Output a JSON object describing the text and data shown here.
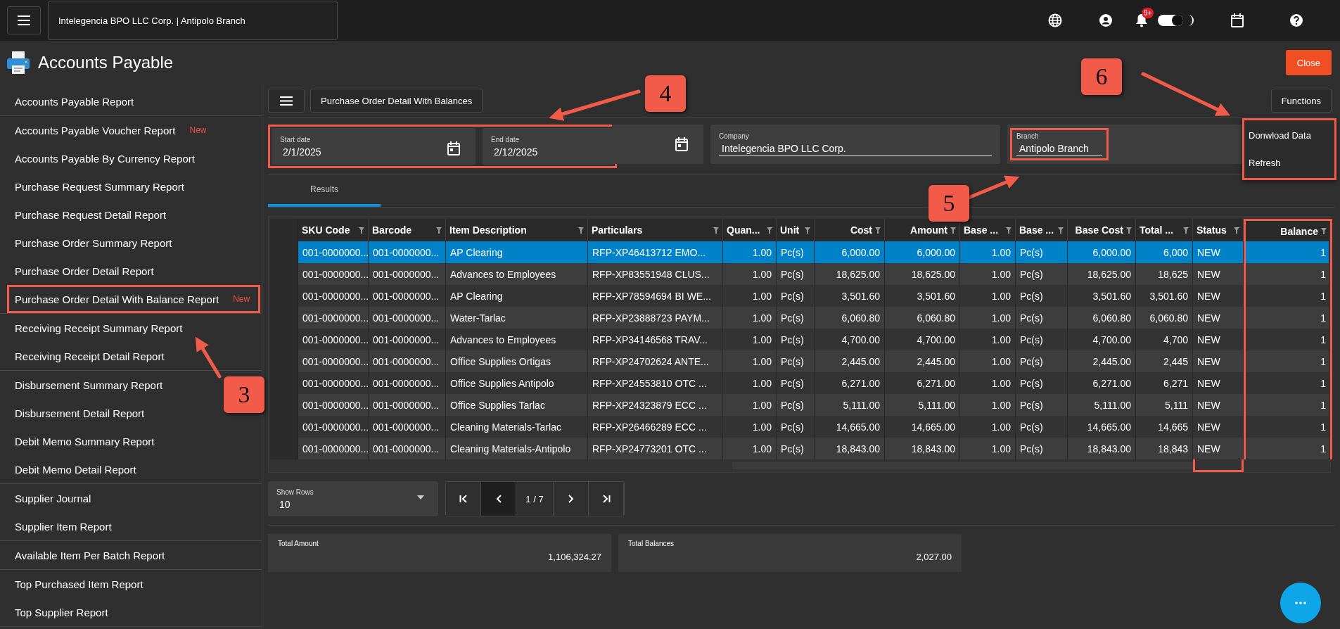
{
  "topbar": {
    "company": "Intelegencia BPO LLC Corp. | Antipolo Branch",
    "notification_count": "9+",
    "dark_mode": true
  },
  "page": {
    "title": "Accounts Payable",
    "close": "Close"
  },
  "sidebar": {
    "groups": [
      [
        {
          "label": "Accounts Payable Report",
          "highlighted": false
        }
      ],
      [
        {
          "label": "Accounts Payable Voucher Report",
          "badge": "New",
          "highlighted": false
        },
        {
          "label": "Accounts Payable By Currency Report",
          "highlighted": false
        },
        {
          "label": "Purchase Request Summary Report",
          "highlighted": false
        },
        {
          "label": "Purchase Request Detail Report",
          "highlighted": false
        },
        {
          "label": "Purchase Order Summary Report",
          "highlighted": false
        },
        {
          "label": "Purchase Order Detail Report",
          "highlighted": false
        },
        {
          "label": "Purchase Order Detail With Balance Report",
          "badge": "New",
          "highlighted": true
        }
      ],
      [
        {
          "label": "Receiving Receipt Summary Report",
          "highlighted": false
        },
        {
          "label": "Receiving Receipt Detail Report",
          "highlighted": false
        }
      ],
      [
        {
          "label": "Disbursement Summary Report",
          "highlighted": false
        },
        {
          "label": "Disbursement Detail Report",
          "highlighted": false
        },
        {
          "label": "Debit Memo Summary Report",
          "highlighted": false
        },
        {
          "label": "Debit Memo Detail Report",
          "highlighted": false
        }
      ],
      [
        {
          "label": "Supplier Journal",
          "highlighted": false
        },
        {
          "label": "Supplier Item Report",
          "highlighted": false
        }
      ],
      [
        {
          "label": "Available Item Per Batch Report",
          "highlighted": false
        }
      ],
      [
        {
          "label": "Top Purchased Item Report",
          "highlighted": false
        },
        {
          "label": "Top Supplier Report",
          "highlighted": false
        }
      ]
    ]
  },
  "toolbar": {
    "report": "Purchase Order Detail With Balances",
    "functions": "Functions"
  },
  "functions_menu": {
    "items": [
      "Donwload Data",
      "Refresh"
    ],
    "outlined": true
  },
  "filters": {
    "date_range_outlined": true,
    "start_date": {
      "label": "Start date",
      "value": "2/1/2025"
    },
    "end_date": {
      "label": "End date",
      "value": "2/12/2025"
    },
    "company": {
      "label": "Company",
      "value": "Intelegencia BPO LLC Corp."
    },
    "branch": {
      "label": "Branch",
      "value": "Antipolo Branch",
      "outlined": true
    }
  },
  "tabs": [
    {
      "label": "Results",
      "selected": true
    }
  ],
  "table": {
    "columns": [
      {
        "label": "SKU Code",
        "outlined": false
      },
      {
        "label": "Barcode",
        "outlined": false
      },
      {
        "label": "Item Description",
        "outlined": false
      },
      {
        "label": "Particulars",
        "outlined": false
      },
      {
        "label": "Quan...",
        "outlined": false
      },
      {
        "label": "Unit",
        "outlined": false
      },
      {
        "label": "Cost",
        "outlined": false
      },
      {
        "label": "Amount",
        "outlined": false
      },
      {
        "label": "Base ...",
        "outlined": false
      },
      {
        "label": "Base ...",
        "outlined": false
      },
      {
        "label": "Base Cost",
        "outlined": false
      },
      {
        "label": "Total ...",
        "outlined": false
      },
      {
        "label": "Status",
        "outlined": false
      },
      {
        "label": "Balance",
        "outlined": true
      }
    ],
    "rows": [
      {
        "selected": true,
        "cells": [
          "001-0000000...",
          "001-0000000...",
          "AP Clearing",
          "RFP-XP46413712 EMO...",
          "1.00",
          "Pc(s)",
          "6,000.00",
          "6,000.00",
          "1.00",
          "Pc(s)",
          "6,000.00",
          "6,000",
          "NEW",
          "1"
        ]
      },
      {
        "selected": false,
        "cells": [
          "001-0000000...",
          "001-0000000...",
          "Advances to Employees",
          "RFP-XP83551948 CLUS...",
          "1.00",
          "Pc(s)",
          "18,625.00",
          "18,625.00",
          "1.00",
          "Pc(s)",
          "18,625.00",
          "18,625",
          "NEW",
          "1"
        ]
      },
      {
        "selected": false,
        "cells": [
          "001-0000000...",
          "001-0000000...",
          "AP Clearing",
          "RFP-XP78594694 BI WE...",
          "1.00",
          "Pc(s)",
          "3,501.60",
          "3,501.60",
          "1.00",
          "Pc(s)",
          "3,501.60",
          "3,501.60",
          "NEW",
          "1"
        ]
      },
      {
        "selected": false,
        "cells": [
          "001-0000000...",
          "001-0000000...",
          "Water-Tarlac",
          "RFP-XP23888723 PAYM...",
          "1.00",
          "Pc(s)",
          "6,060.80",
          "6,060.80",
          "1.00",
          "Pc(s)",
          "6,060.80",
          "6,060.80",
          "NEW",
          "1"
        ]
      },
      {
        "selected": false,
        "cells": [
          "001-0000000...",
          "001-0000000...",
          "Advances to Employees",
          "RFP-XP34146568 TRAV...",
          "1.00",
          "Pc(s)",
          "4,700.00",
          "4,700.00",
          "1.00",
          "Pc(s)",
          "4,700.00",
          "4,700",
          "NEW",
          "1"
        ]
      },
      {
        "selected": false,
        "cells": [
          "001-0000000...",
          "001-0000000...",
          "Office Supplies Ortigas",
          "RFP-XP24702624 ANTE...",
          "1.00",
          "Pc(s)",
          "2,445.00",
          "2,445.00",
          "1.00",
          "Pc(s)",
          "2,445.00",
          "2,445",
          "NEW",
          "1"
        ]
      },
      {
        "selected": false,
        "cells": [
          "001-0000000...",
          "001-0000000...",
          "Office Supplies Antipolo",
          "RFP-XP24553810 OTC ...",
          "1.00",
          "Pc(s)",
          "6,271.00",
          "6,271.00",
          "1.00",
          "Pc(s)",
          "6,271.00",
          "6,271",
          "NEW",
          "1"
        ]
      },
      {
        "selected": false,
        "cells": [
          "001-0000000...",
          "001-0000000...",
          "Office Supplies Tarlac",
          "RFP-XP24323879 ECC ...",
          "1.00",
          "Pc(s)",
          "5,111.00",
          "5,111.00",
          "1.00",
          "Pc(s)",
          "5,111.00",
          "5,111",
          "NEW",
          "1"
        ]
      },
      {
        "selected": false,
        "cells": [
          "001-0000000...",
          "001-0000000...",
          "Cleaning Materials-Tarlac",
          "RFP-XP26466289 ECC ...",
          "1.00",
          "Pc(s)",
          "14,665.00",
          "14,665.00",
          "1.00",
          "Pc(s)",
          "14,665.00",
          "14,665",
          "NEW",
          "1"
        ]
      },
      {
        "selected": false,
        "cells": [
          "001-0000000...",
          "001-0000000...",
          "Cleaning Materials-Antipolo",
          "RFP-XP24773201 OTC ...",
          "1.00",
          "Pc(s)",
          "18,843.00",
          "18,843.00",
          "1.00",
          "Pc(s)",
          "18,843.00",
          "18,843",
          "NEW",
          "1"
        ]
      }
    ]
  },
  "pagination": {
    "show_rows_label": "Show Rows",
    "show_rows_value": "10",
    "page": "1 / 7"
  },
  "totals": [
    {
      "label": "Total Amount",
      "value": "1,106,324.27"
    },
    {
      "label": "Total Balances",
      "value": "2,027.00"
    }
  ],
  "callouts": [
    {
      "number": "3"
    },
    {
      "number": "4"
    },
    {
      "number": "5"
    },
    {
      "number": "6"
    }
  ]
}
